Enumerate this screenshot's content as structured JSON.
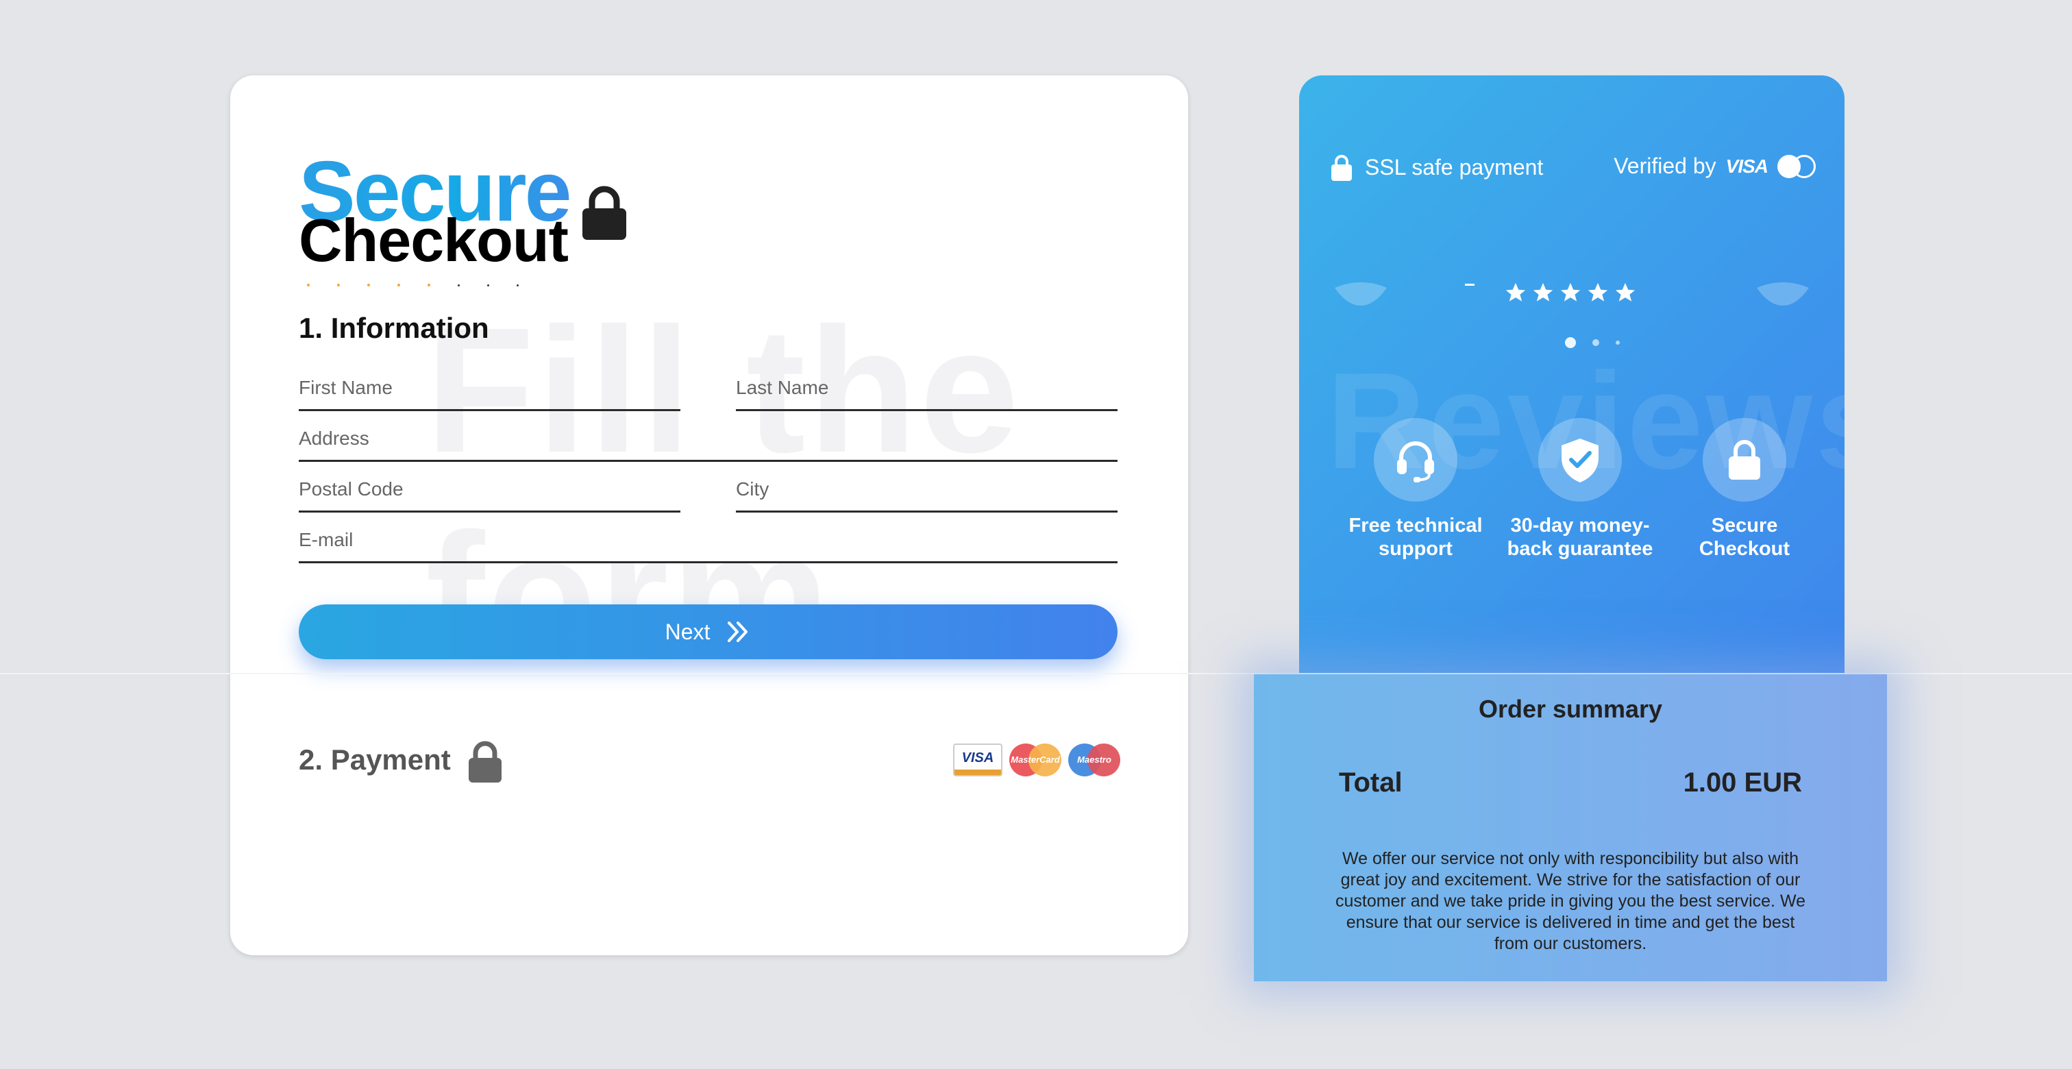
{
  "header": {
    "title_line1": "Secure",
    "title_line2": "Checkout"
  },
  "form": {
    "watermark": "Fill the\nform",
    "section1_title": "1. Information",
    "fields": {
      "first_name": {
        "placeholder": "First Name",
        "value": ""
      },
      "last_name": {
        "placeholder": "Last Name",
        "value": ""
      },
      "address": {
        "placeholder": "Address",
        "value": ""
      },
      "postal_code": {
        "placeholder": "Postal Code",
        "value": ""
      },
      "city": {
        "placeholder": "City",
        "value": ""
      },
      "email": {
        "placeholder": "E-mail",
        "value": ""
      }
    },
    "next_label": "Next",
    "section2_title": "2. Payment",
    "card_brands": [
      "VISA",
      "MasterCard",
      "Maestro"
    ]
  },
  "trust": {
    "ssl_text": "SSL safe payment",
    "verified_text": "Verified by",
    "verified_brand": "VISA",
    "watermark": "Reviews",
    "rating_stars": 5,
    "carousel_pages": 3,
    "carousel_active": 1,
    "features": [
      {
        "icon": "headset-icon",
        "label": "Free technical support"
      },
      {
        "icon": "shield-check-icon",
        "label": "30-day money-back guarantee"
      },
      {
        "icon": "lock-icon",
        "label": "Secure Checkout"
      }
    ]
  },
  "summary": {
    "title": "Order summary",
    "total_label": "Total",
    "total_value": "1.00 EUR",
    "note": "We offer our service not only with responcibility but also with great joy and excitement. We strive for the satisfaction of our customer and we take pride in giving you the best service. We ensure that our service is delivered in time and get the best from our customers."
  },
  "colors": {
    "accent_start": "#2aa6e2",
    "accent_end": "#4282ec",
    "star": "#f3a931",
    "page_bg": "#e3e5e9"
  }
}
